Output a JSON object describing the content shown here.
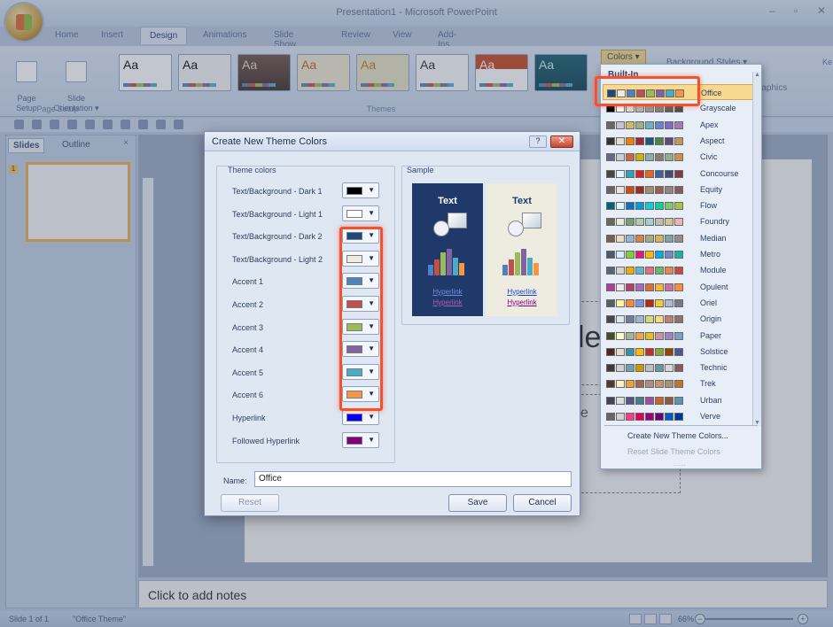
{
  "window": {
    "title": "Presentation1 - Microsoft PowerPoint",
    "controls": [
      "–",
      "▫",
      "✕"
    ]
  },
  "tabs": [
    "Home",
    "Insert",
    "Design",
    "Animations",
    "Slide Show",
    "Review",
    "View",
    "Add-Ins"
  ],
  "active_tab": "Design",
  "ribbon": {
    "page_setup_label": "Page\nSetup",
    "slide_orientation_label": "Slide\nOrientation ▾",
    "page_setup_group": "Page Setup",
    "themes_group": "Themes",
    "theme_sample_text": "Aa",
    "colors_button": "Colors ▾",
    "background_styles": "Background Styles ▾",
    "graphics_fragment": "raphics",
    "right_fragment": "Ke"
  },
  "slides_pane": {
    "tab_slides": "Slides",
    "tab_outline": "Outline",
    "close": "×",
    "slide_number": "1"
  },
  "slide": {
    "title_fragment": "le",
    "subtitle_fragment": "e"
  },
  "notes": {
    "placeholder": "Click to add notes"
  },
  "status": {
    "slide_info": "Slide 1 of 1",
    "theme": "\"Office Theme\"",
    "zoom": "66%",
    "zoom_minus": "−",
    "zoom_plus": "+"
  },
  "dialog": {
    "title": "Create New Theme Colors",
    "help": "?",
    "close": "✕",
    "theme_colors_label": "Theme colors",
    "sample_label": "Sample",
    "rows": [
      {
        "label": "Text/Background - Dark 1",
        "color": "#000000"
      },
      {
        "label": "Text/Background - Light 1",
        "color": "#ffffff"
      },
      {
        "label": "Text/Background - Dark 2",
        "color": "#1f497d"
      },
      {
        "label": "Text/Background - Light 2",
        "color": "#eeece1"
      },
      {
        "label": "Accent 1",
        "color": "#4f81bd"
      },
      {
        "label": "Accent 2",
        "color": "#c0504d"
      },
      {
        "label": "Accent 3",
        "color": "#9bbb59"
      },
      {
        "label": "Accent 4",
        "color": "#8064a2"
      },
      {
        "label": "Accent 5",
        "color": "#4bacc6"
      },
      {
        "label": "Accent 6",
        "color": "#f79646"
      },
      {
        "label": "Hyperlink",
        "color": "#0000ff"
      },
      {
        "label": "Followed Hyperlink",
        "color": "#800080"
      }
    ],
    "sample": {
      "dark_text": "Text",
      "light_text": "Text",
      "hyperlink": "Hyperlink",
      "followed": "Hyperlink"
    },
    "name_label": "Name:",
    "name_value": "Office",
    "reset_button": "Reset",
    "save_button": "Save",
    "cancel_button": "Cancel"
  },
  "dropdown": {
    "header": "Built-In",
    "items": [
      {
        "name": "Office",
        "colors": [
          "#1f497d",
          "#eeece1",
          "#4f81bd",
          "#c0504d",
          "#9bbb59",
          "#8064a2",
          "#4bacc6",
          "#f79646"
        ]
      },
      {
        "name": "Grayscale",
        "colors": [
          "#000000",
          "#f8f8f8",
          "#dddddd",
          "#b2b2b2",
          "#969696",
          "#808080",
          "#5f5f5f",
          "#4d4d4d"
        ]
      },
      {
        "name": "Apex",
        "colors": [
          "#69676d",
          "#c9c2d1",
          "#ceb966",
          "#9cb084",
          "#6bb1c9",
          "#6585cf",
          "#7e6bc9",
          "#a379bb"
        ]
      },
      {
        "name": "Aspect",
        "colors": [
          "#323232",
          "#e3ded1",
          "#f07f09",
          "#9f2936",
          "#1b587c",
          "#4e8542",
          "#604878",
          "#c19859"
        ]
      },
      {
        "name": "Civic",
        "colors": [
          "#646b86",
          "#c5d1d7",
          "#d16349",
          "#ccb400",
          "#8cadae",
          "#8c7b70",
          "#8fb08c",
          "#d19049"
        ]
      },
      {
        "name": "Concourse",
        "colors": [
          "#464646",
          "#def5fa",
          "#2da2bf",
          "#da1f28",
          "#eb641b",
          "#39639d",
          "#474b78",
          "#7d3c4a"
        ]
      },
      {
        "name": "Equity",
        "colors": [
          "#696464",
          "#e9e5dc",
          "#d34817",
          "#9b2d1f",
          "#a28e6a",
          "#956251",
          "#918485",
          "#855d5d"
        ]
      },
      {
        "name": "Flow",
        "colors": [
          "#04617b",
          "#dbf5f9",
          "#0f6fc6",
          "#009dd9",
          "#0bd0d9",
          "#10cf9b",
          "#7cca62",
          "#a5c249"
        ]
      },
      {
        "name": "Foundry",
        "colors": [
          "#676a55",
          "#eaebde",
          "#72a376",
          "#b0ccb0",
          "#a8cdd7",
          "#c0beaf",
          "#cec597",
          "#e8b7b7"
        ]
      },
      {
        "name": "Median",
        "colors": [
          "#775f55",
          "#ebddc3",
          "#94b6d2",
          "#dd8047",
          "#a5ab81",
          "#d8b25c",
          "#7ba79d",
          "#968c8c"
        ]
      },
      {
        "name": "Metro",
        "colors": [
          "#4e5b6f",
          "#d6ecff",
          "#7fd13b",
          "#ea157a",
          "#feb80a",
          "#00addc",
          "#738ac8",
          "#1ab39f"
        ]
      },
      {
        "name": "Module",
        "colors": [
          "#5a6378",
          "#d4d4d6",
          "#f0ad00",
          "#60b5cc",
          "#e66c7d",
          "#6bb76d",
          "#e88651",
          "#c64847"
        ]
      },
      {
        "name": "Opulent",
        "colors": [
          "#b13f9a",
          "#f4e7ed",
          "#b83d68",
          "#ac66bb",
          "#de6c36",
          "#f9b639",
          "#cf6da4",
          "#fa8d3d"
        ]
      },
      {
        "name": "Oriel",
        "colors": [
          "#575f6d",
          "#fff39d",
          "#fe8637",
          "#7598d9",
          "#b32c16",
          "#f5cd2d",
          "#aebad5",
          "#777c84"
        ]
      },
      {
        "name": "Origin",
        "colors": [
          "#464653",
          "#dde9ec",
          "#727ca3",
          "#9fb8cd",
          "#d2da7a",
          "#fada7a",
          "#b88472",
          "#8e736a"
        ]
      },
      {
        "name": "Paper",
        "colors": [
          "#444d26",
          "#fefac9",
          "#a5b592",
          "#f3a447",
          "#e7bc29",
          "#d092a7",
          "#9c85c0",
          "#809ec2"
        ]
      },
      {
        "name": "Solstice",
        "colors": [
          "#4f271c",
          "#e7dec9",
          "#3891a7",
          "#feb80a",
          "#c32d2e",
          "#84aa33",
          "#964305",
          "#475a8d"
        ]
      },
      {
        "name": "Technic",
        "colors": [
          "#3b3b3b",
          "#d4d2d0",
          "#6ea0b0",
          "#cc9900",
          "#c0c0c0",
          "#669999",
          "#d8d8d8",
          "#855d5d"
        ]
      },
      {
        "name": "Trek",
        "colors": [
          "#4e3b30",
          "#fbeec9",
          "#f0a22e",
          "#a5644e",
          "#b58b80",
          "#c3986d",
          "#a19574",
          "#c17529"
        ]
      },
      {
        "name": "Urban",
        "colors": [
          "#424456",
          "#dedede",
          "#53548a",
          "#438086",
          "#a04da3",
          "#c4652d",
          "#8b5d3d",
          "#5c92b5"
        ]
      },
      {
        "name": "Verve",
        "colors": [
          "#666666",
          "#d2d2d2",
          "#ff388c",
          "#e40059",
          "#9c007f",
          "#68007f",
          "#005bd3",
          "#00349e"
        ]
      }
    ],
    "create_new": "Create New Theme Colors...",
    "reset_slide": "Reset Slide Theme Colors",
    "grip": "....."
  }
}
